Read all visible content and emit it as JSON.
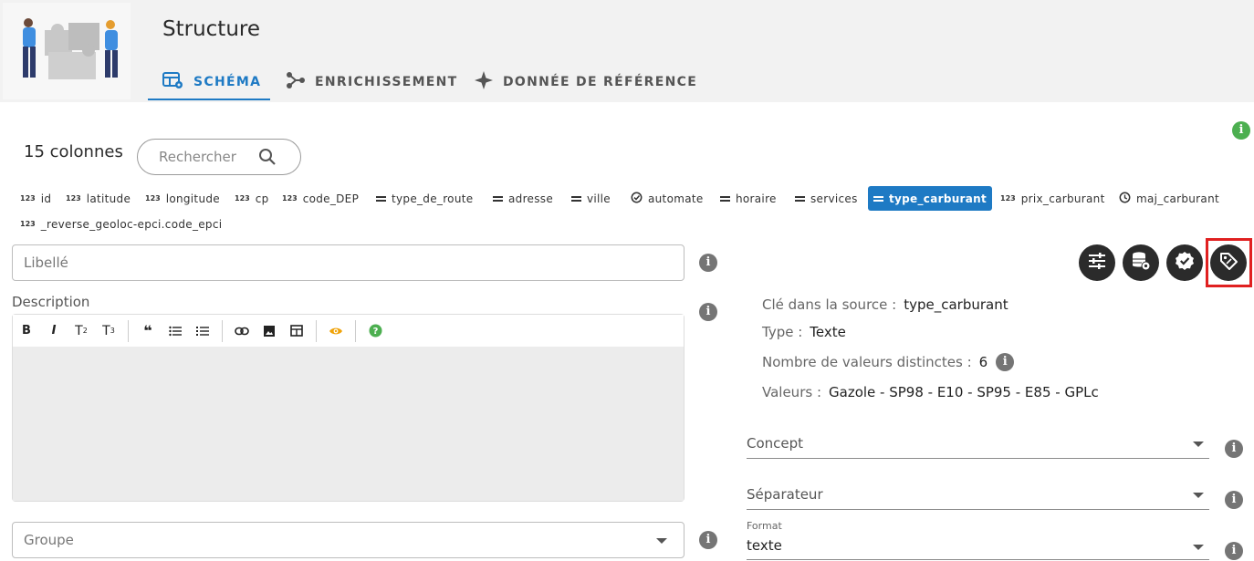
{
  "header": {
    "title": "Structure",
    "tabs": [
      {
        "label": "SCHÉMA",
        "icon": "table-settings-icon",
        "active": true
      },
      {
        "label": "ENRICHISSEMENT",
        "icon": "graph-icon",
        "active": false
      },
      {
        "label": "DONNÉE DE RÉFÉRENCE",
        "icon": "sparkle-icon",
        "active": false
      }
    ]
  },
  "toolbar": {
    "column_count": "15 colonnes",
    "search_placeholder": "Rechercher"
  },
  "columns": [
    {
      "name": "id",
      "kind": "number"
    },
    {
      "name": "latitude",
      "kind": "number"
    },
    {
      "name": "longitude",
      "kind": "number"
    },
    {
      "name": "cp",
      "kind": "number"
    },
    {
      "name": "code_DEP",
      "kind": "number"
    },
    {
      "name": "type_de_route",
      "kind": "text"
    },
    {
      "name": "adresse",
      "kind": "text"
    },
    {
      "name": "ville",
      "kind": "text"
    },
    {
      "name": "automate",
      "kind": "boolean"
    },
    {
      "name": "horaire",
      "kind": "text"
    },
    {
      "name": "services",
      "kind": "text"
    },
    {
      "name": "type_carburant",
      "kind": "text",
      "active": true
    },
    {
      "name": "prix_carburant",
      "kind": "number"
    },
    {
      "name": "maj_carburant",
      "kind": "date"
    },
    {
      "name": "_reverse_geoloc-epci.code_epci",
      "kind": "number"
    }
  ],
  "left": {
    "libelle_placeholder": "Libellé",
    "description_label": "Description",
    "groupe_placeholder": "Groupe"
  },
  "editor_toolbar": [
    "B",
    "I",
    "T2",
    "T3",
    "quote",
    "bullet-list",
    "numbered-list",
    "link",
    "image",
    "table",
    "preview",
    "help"
  ],
  "details": {
    "source_key_label": "Clé dans la source :",
    "source_key_value": "type_carburant",
    "type_label": "Type :",
    "type_value": "Texte",
    "distinct_label": "Nombre de valeurs distinctes :",
    "distinct_value": "6",
    "values_label": "Valeurs :",
    "values_value": "Gazole - SP98 - E10 - SP95 - E85 - GPLc"
  },
  "selects": {
    "concept_label": "Concept",
    "separator_label": "Séparateur",
    "format_label": "Format",
    "format_value": "texte"
  },
  "actions": [
    "sliders-icon",
    "database-settings-icon",
    "verified-badge-icon",
    "tag-icon"
  ],
  "info_glyph": "i",
  "colors": {
    "accent": "#1e7ac4",
    "highlight": "#e02020",
    "info_green": "#4caf50"
  }
}
